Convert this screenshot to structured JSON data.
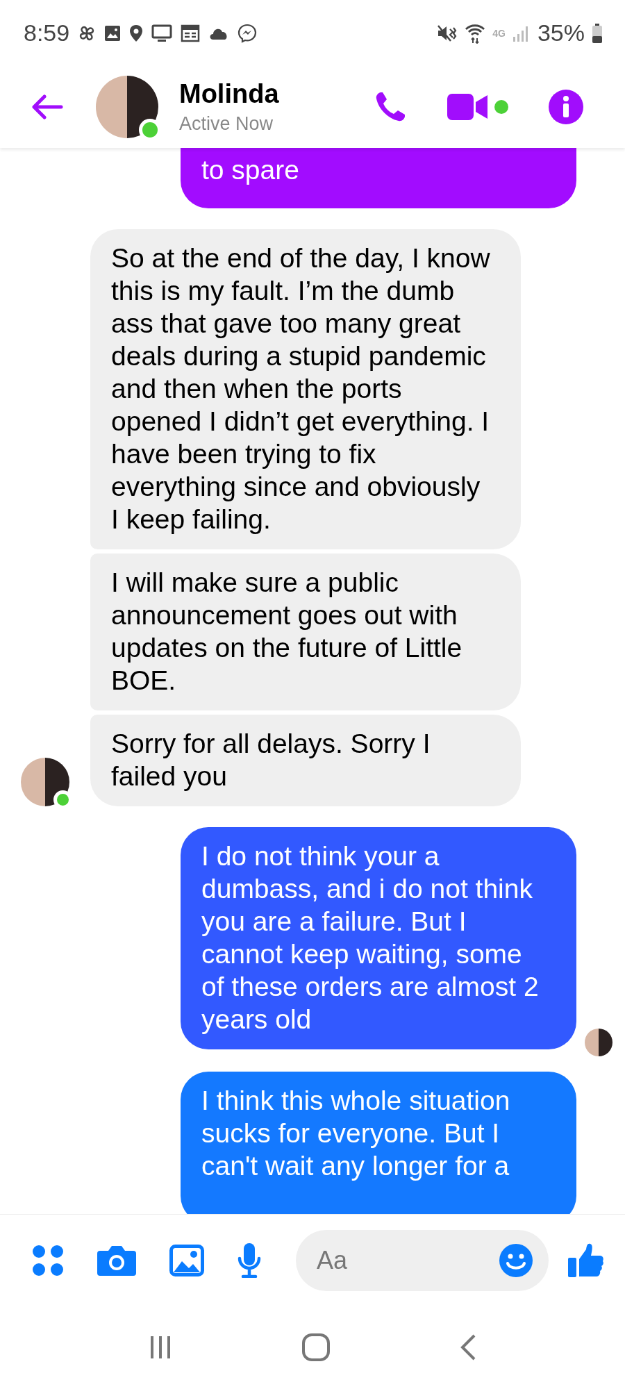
{
  "status_bar": {
    "time": "8:59",
    "battery": "35%",
    "network": "4G"
  },
  "header": {
    "name": "Molinda",
    "status": "Active Now",
    "online": true
  },
  "messages": [
    {
      "kind": "sent",
      "text": "to spare",
      "color": "#a20cff",
      "cut_top": true,
      "seen": false
    },
    {
      "kind": "received",
      "text": "So at the end of the day, I know this is my fault. I’m the dumb ass that gave too many great deals during a stupid pandemic and then when the ports opened I didn’t get everything. I have been trying to fix everything since and obviously I keep failing.",
      "show_avatar": false
    },
    {
      "kind": "received",
      "text": "I will make sure a public announcement goes out with updates on the future of Little BOE.",
      "show_avatar": false
    },
    {
      "kind": "received",
      "text": "Sorry for all delays. Sorry I failed you",
      "show_avatar": true
    },
    {
      "kind": "sent",
      "text": "I do not think your a dumbass, and i do not think you are a failure. But I cannot keep waiting, some of these orders are almost 2 years old",
      "color": "#3259ff",
      "seen": true
    },
    {
      "kind": "sent",
      "text": "I think this whole situation sucks for everyone. But I can't wait any longer for a",
      "color": "#1479ff",
      "cut_bottom": true,
      "seen": false
    }
  ],
  "composer": {
    "placeholder": "Aa"
  }
}
